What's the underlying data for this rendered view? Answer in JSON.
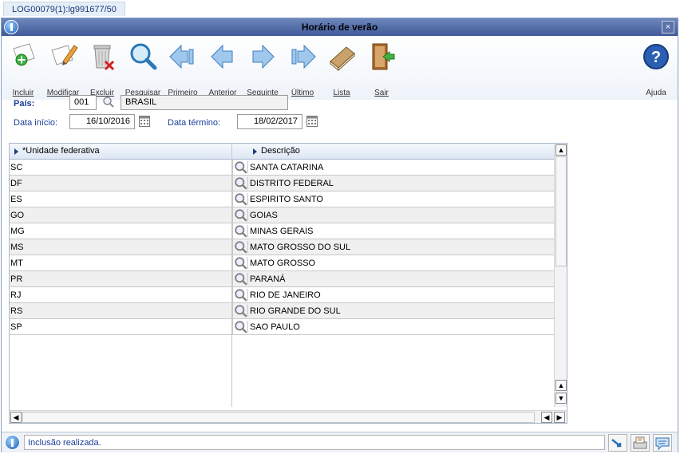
{
  "page_tab": "LOG00079(1):lg991677/50",
  "window": {
    "title": "Horário de verão"
  },
  "toolbar": {
    "buttons": [
      {
        "label": "Incluir",
        "icon": "add-document-icon"
      },
      {
        "label": "Modificar",
        "icon": "edit-document-icon"
      },
      {
        "label": "Excluir",
        "icon": "trash-icon"
      },
      {
        "label": "Pesquisar",
        "icon": "magnifier-icon"
      },
      {
        "label": "Primeiro",
        "icon": "first-arrow-icon"
      },
      {
        "label": "Anterior",
        "icon": "previous-arrow-icon"
      },
      {
        "label": "Seguinte",
        "icon": "next-arrow-icon"
      },
      {
        "label": "Último",
        "icon": "last-arrow-icon"
      },
      {
        "label": "Lista",
        "icon": "book-icon"
      },
      {
        "label": "Sair",
        "icon": "exit-door-icon"
      }
    ],
    "help_label": "Ajuda"
  },
  "form": {
    "pais_label": "País:",
    "pais_code": "001",
    "pais_name": "BRASIL",
    "data_inicio_label": "Data início:",
    "data_inicio": "16/10/2016",
    "data_termino_label": "Data término:",
    "data_termino": "18/02/2017"
  },
  "grid": {
    "columns": [
      "*Unidade federativa",
      "Descrição"
    ],
    "rows": [
      {
        "uf": "SC",
        "descricao": "SANTA CATARINA"
      },
      {
        "uf": "DF",
        "descricao": "DISTRITO FEDERAL"
      },
      {
        "uf": "ES",
        "descricao": "ESPIRITO SANTO"
      },
      {
        "uf": "GO",
        "descricao": "GOIAS"
      },
      {
        "uf": "MG",
        "descricao": "MINAS GERAIS"
      },
      {
        "uf": "MS",
        "descricao": "MATO GROSSO DO SUL"
      },
      {
        "uf": "MT",
        "descricao": "MATO GROSSO"
      },
      {
        "uf": "PR",
        "descricao": "PARANÁ"
      },
      {
        "uf": "RJ",
        "descricao": "RIO DE JANEIRO"
      },
      {
        "uf": "RS",
        "descricao": "RIO GRANDE DO SUL"
      },
      {
        "uf": "SP",
        "descricao": "SAO PAULO"
      }
    ]
  },
  "status": {
    "message": "Inclusão realizada."
  },
  "colors": {
    "title_bar": "#4a64a3",
    "accent_blue": "#1a3d9a",
    "row_alt": "#f0f0f0"
  }
}
